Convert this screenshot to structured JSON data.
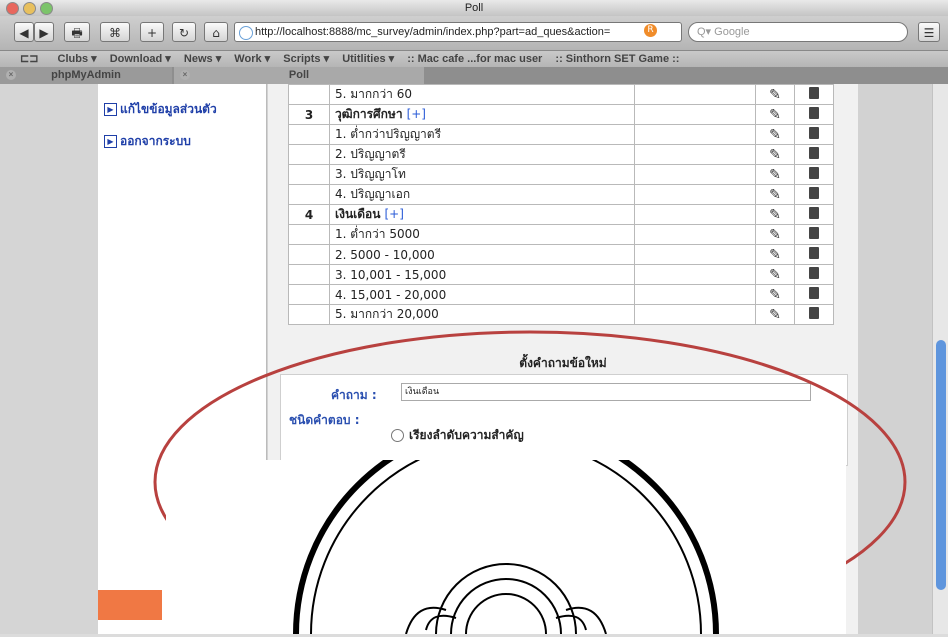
{
  "window": {
    "title": "Poll"
  },
  "toolbar": {
    "url": "http://localhost:8888/mc_survey/admin/index.php?part=ad_ques&action=",
    "search_placeholder": "Google",
    "back_label": "◀",
    "forward_label": "▶",
    "print_label": "🖶",
    "bookmark_label": "⌘",
    "add_label": "+",
    "reload_label": "↻",
    "home_label": "⌂",
    "rss_label": "R",
    "bookmark_menu_label": "☰"
  },
  "bookmarks": [
    "Clubs ▾",
    "Download ▾",
    "News ▾",
    "Work ▾",
    "Scripts ▾",
    "Utitlities ▾",
    ":: Mac cafe ...for mac user",
    ":: Sinthorn SET Game ::"
  ],
  "tabs": [
    {
      "label": "phpMyAdmin",
      "close": "×"
    },
    {
      "label": "Poll",
      "close": "×"
    }
  ],
  "sidebar": {
    "items": [
      {
        "label": "แก้ไขข้อมูลส่วนตัว",
        "icon": "arrow-box-icon",
        "glyph": "▶"
      },
      {
        "label": "ออกจากระบบ",
        "icon": "arrow-box-icon",
        "glyph": "▶"
      }
    ]
  },
  "table": {
    "rows": [
      {
        "num": "",
        "text": "5. มากกว่า 60",
        "type": "answer"
      },
      {
        "num": "3",
        "text": "วุฒิการศึกษา",
        "type": "question",
        "plus": "[+]"
      },
      {
        "num": "",
        "text": "1. ต่ำกว่าปริญญาตรี",
        "type": "answer"
      },
      {
        "num": "",
        "text": "2. ปริญญาตรี",
        "type": "answer"
      },
      {
        "num": "",
        "text": "3. ปริญญาโท",
        "type": "answer"
      },
      {
        "num": "",
        "text": "4. ปริญญาเอก",
        "type": "answer"
      },
      {
        "num": "4",
        "text": "เงินเดือน",
        "type": "question",
        "plus": "[+]"
      },
      {
        "num": "",
        "text": "1. ต่ำกว่า 5000",
        "type": "answer"
      },
      {
        "num": "",
        "text": "2. 5000 - 10,000",
        "type": "answer"
      },
      {
        "num": "",
        "text": "3. 10,001 - 15,000",
        "type": "answer"
      },
      {
        "num": "",
        "text": "4. 15,001 - 20,000",
        "type": "answer"
      },
      {
        "num": "",
        "text": "5. มากกว่า 20,000",
        "type": "answer"
      }
    ],
    "edit_glyph": "✎",
    "trash_icon": "trash-icon"
  },
  "form": {
    "title": "ตั้งคำถามข้อใหม่",
    "question_label": "คำถาม :",
    "question_value": "เงินเดือน",
    "answer_type_label": "ชนิดคำตอบ :",
    "option_rank_label": "เรียงลำดับความสำคัญ"
  },
  "colors": {
    "link_blue": "#1f3fa8",
    "scroll_thumb": "#5e95dd",
    "annotation_red": "#b8413f",
    "sidebar_accent": "#f07844"
  }
}
